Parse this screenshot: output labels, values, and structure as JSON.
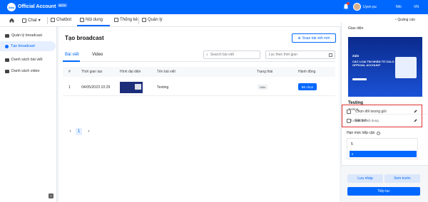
{
  "header": {
    "logo_text": "Zalo",
    "brand": "Official Account",
    "badge": "BETA",
    "user_name": "Uyen pu",
    "language_1": "Nhí",
    "language_2": "VN"
  },
  "navbar": {
    "items": [
      {
        "label": "Chat",
        "icon": "chat-icon"
      },
      {
        "label": "Chatbot",
        "icon": "chatbot-icon"
      },
      {
        "label": "Nội dung",
        "icon": "content-icon"
      },
      {
        "label": "Thống kê",
        "icon": "stats-icon"
      },
      {
        "label": "Quản lý",
        "icon": "grid-icon"
      }
    ],
    "active_index": 2,
    "ads_label": "Quảng cáo"
  },
  "sidebar": {
    "items": [
      {
        "label": "Quản lý broadcast"
      },
      {
        "label": "Tạo broadcast"
      },
      {
        "label": "Danh sách bài viết"
      },
      {
        "label": "Danh sách video"
      }
    ],
    "active_index": 1
  },
  "main": {
    "title": "Tạo broadcast",
    "compose_label": "Soạn bài viết mới",
    "tabs": [
      {
        "label": "Bài viết"
      },
      {
        "label": "Video"
      }
    ],
    "search_placeholder": "Search bài viết",
    "date_placeholder": "Lọc theo thời gian",
    "table": {
      "headers": [
        "#",
        "Thời gian tạo",
        "Hình đại diện",
        "Tên bài viết",
        "Trạng thái",
        "Hành động"
      ],
      "rows": [
        {
          "index": "1",
          "created": "04/05/2023 10:29",
          "title": "Testing",
          "status": "Hiện",
          "action": "Bỏ chọn"
        }
      ]
    },
    "pagination": {
      "prev": "‹",
      "current": "1",
      "next": "›"
    }
  },
  "right_panel": {
    "section_label": "Giao diện",
    "preview": {
      "logo": "Zalo",
      "headline": "CÁC LOẠI TIN NHẮN TỪ ZALO OFFICIAL ACCOUNT"
    },
    "article_title": "Testing",
    "article_sub": "Testing",
    "selected_count": "Đã chọn 1/5 nội dung",
    "options": [
      {
        "label": "Chọn đối tượng gửi",
        "checked": false
      },
      {
        "label": "Đặt lịch",
        "checked": false
      }
    ],
    "reach_label": "Hạn mức tiếp cận",
    "reach_value": "5",
    "reach_bar_value": "5",
    "buttons": {
      "draft": "Lưu nháp",
      "preview": "Xem trước",
      "continue": "Tiếp tục"
    }
  },
  "colors": {
    "primary": "#0068ff",
    "highlight_border": "#e03131"
  }
}
